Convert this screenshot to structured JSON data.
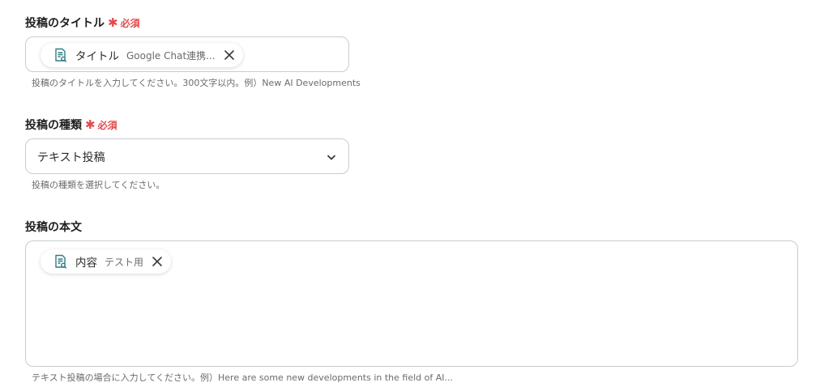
{
  "title_field": {
    "label": "投稿のタイトル",
    "required_label": "必須",
    "chip_name": "タイトル",
    "chip_value": "Google Chat連携...",
    "help": "投稿のタイトルを入力してください。300文字以内。例）New AI Developments"
  },
  "type_field": {
    "label": "投稿の種類",
    "required_label": "必須",
    "selected": "テキスト投稿",
    "help": "投稿の種類を選択してください。"
  },
  "body_field": {
    "label": "投稿の本文",
    "chip_name": "内容",
    "chip_value": "テスト用",
    "help": "テキスト投稿の場合に入力してください。例）Here are some new developments in the field of AI..."
  },
  "icons": {
    "chip_icon": "document-search-icon",
    "remove_icon": "close-icon",
    "dropdown_icon": "chevron-down-icon"
  },
  "colors": {
    "required": "#e5484d",
    "chip_icon": "#2f7d86"
  }
}
